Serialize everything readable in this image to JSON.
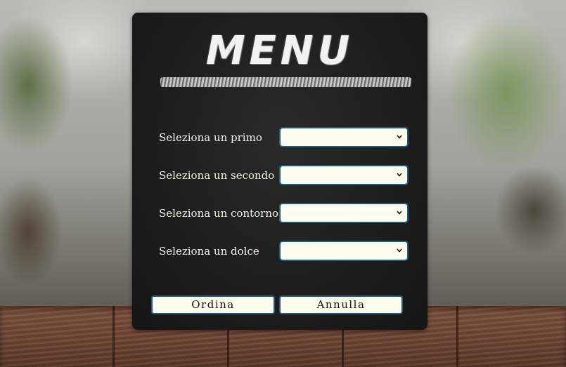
{
  "menu": {
    "title": "MENU",
    "fields": [
      {
        "label": "Seleziona un primo",
        "value": ""
      },
      {
        "label": "Seleziona un secondo",
        "value": ""
      },
      {
        "label": "Seleziona un contorno",
        "value": ""
      },
      {
        "label": "Seleziona un dolce",
        "value": ""
      }
    ],
    "buttons": {
      "order": "Ordina",
      "cancel": "Annulla"
    }
  },
  "colors": {
    "panel": "#1d1d1b",
    "field_bg": "#fefdee",
    "field_border": "#1c5f7a",
    "label_text": "#f4f1e6"
  },
  "icons": {
    "select_arrow": "chevron-down-icon"
  }
}
